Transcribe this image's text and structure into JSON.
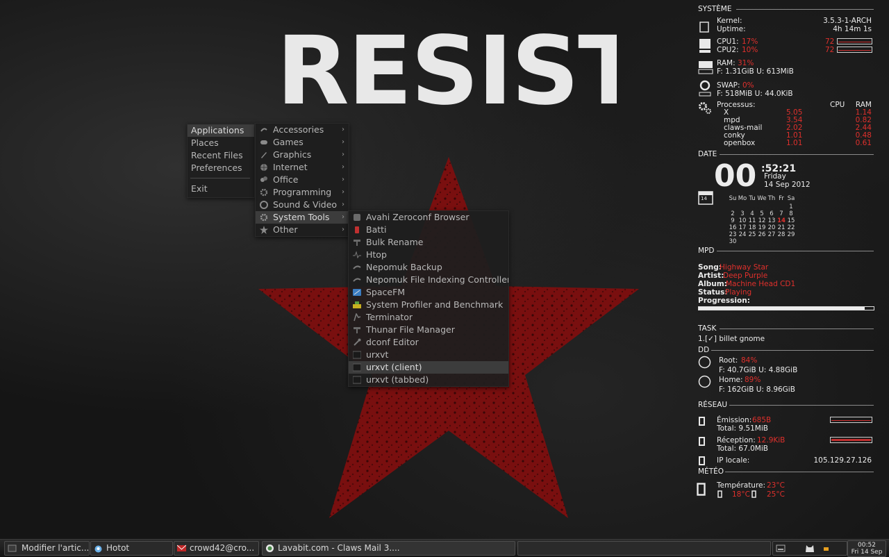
{
  "wallpaper": {
    "title": "RESIST"
  },
  "menu": {
    "main": [
      {
        "label": "Applications",
        "active": true
      },
      {
        "label": "Places"
      },
      {
        "label": "Recent Files"
      },
      {
        "label": "Preferences"
      },
      {
        "label": "Exit"
      }
    ],
    "applications": [
      {
        "label": "Accessories",
        "icon": "accessories-icon"
      },
      {
        "label": "Games",
        "icon": "gamepad-icon"
      },
      {
        "label": "Graphics",
        "icon": "brush-icon"
      },
      {
        "label": "Internet",
        "icon": "globe-icon"
      },
      {
        "label": "Office",
        "icon": "office-icon"
      },
      {
        "label": "Programming",
        "icon": "gear-icon"
      },
      {
        "label": "Sound & Video",
        "icon": "film-icon"
      },
      {
        "label": "System Tools",
        "icon": "gear-icon"
      },
      {
        "label": "Other",
        "icon": "star-icon"
      }
    ],
    "system_tools": [
      {
        "label": "Avahi Zeroconf Browser",
        "icon": "avahi-icon"
      },
      {
        "label": "Batti",
        "icon": "battery-icon"
      },
      {
        "label": "Bulk Rename",
        "icon": "rename-icon"
      },
      {
        "label": "Htop",
        "icon": "pulse-icon"
      },
      {
        "label": "Nepomuk Backup",
        "icon": "nepomuk-icon"
      },
      {
        "label": "Nepomuk File Indexing Controller",
        "icon": "nepomuk-icon"
      },
      {
        "label": "SpaceFM",
        "icon": "spacefm-icon"
      },
      {
        "label": "System Profiler and Benchmark",
        "icon": "profiler-icon"
      },
      {
        "label": "Terminator",
        "icon": "terminator-icon"
      },
      {
        "label": "Thunar File Manager",
        "icon": "thunar-icon"
      },
      {
        "label": "dconf Editor",
        "icon": "wrench-icon"
      },
      {
        "label": "urxvt",
        "icon": "terminal-icon"
      },
      {
        "label": "urxvt (client)",
        "icon": "terminal-icon"
      },
      {
        "label": "urxvt (tabbed)",
        "icon": "terminal-icon"
      }
    ]
  },
  "conky": {
    "systeme": {
      "heading": "SYSTÈME",
      "kernel_label": "Kernel:",
      "kernel": "3.5.3-1-ARCH",
      "uptime_label": "Uptime:",
      "uptime": "4h 14m 1s",
      "cpu1_label": "CPU1:",
      "cpu1": "17%",
      "cpu1_temp": "72",
      "cpu2_label": "CPU2:",
      "cpu2": "10%",
      "cpu2_temp": "72",
      "ram_label": "RAM:",
      "ram": "31%",
      "ram_detail": "F: 1.31GiB U: 613MiB",
      "swap_label": "SWAP:",
      "swap": "0%",
      "swap_detail": "F: 518MiB U: 44.0KiB",
      "proc_label": "Processus:",
      "proc_cpu_header": "CPU",
      "proc_ram_header": "RAM",
      "processes": [
        {
          "name": "X",
          "cpu": "5.05",
          "ram": "1.14"
        },
        {
          "name": "mpd",
          "cpu": "3.54",
          "ram": "0.82"
        },
        {
          "name": "claws-mail",
          "cpu": "2.02",
          "ram": "2.44"
        },
        {
          "name": "conky",
          "cpu": "1.01",
          "ram": "0.48"
        },
        {
          "name": "openbox",
          "cpu": "1.01",
          "ram": "0.61"
        }
      ]
    },
    "date": {
      "heading": "DATE",
      "hour": "00",
      "min_sec": ":52:21",
      "weekday": "Friday",
      "full": "14 Sep 2012",
      "cal_icon_day": "14",
      "weekdays": [
        "Su",
        "Mo",
        "Tu",
        "We",
        "Th",
        "Fr",
        "Sa"
      ],
      "weeks": [
        [
          "",
          "",
          "",
          "",
          "",
          "",
          "1"
        ],
        [
          "2",
          "3",
          "4",
          "5",
          "6",
          "7",
          "8"
        ],
        [
          "9",
          "10",
          "11",
          "12",
          "13",
          "14",
          "15"
        ],
        [
          "16",
          "17",
          "18",
          "19",
          "20",
          "21",
          "22"
        ],
        [
          "23",
          "24",
          "25",
          "26",
          "27",
          "28",
          "29"
        ],
        [
          "30",
          "",
          "",
          "",
          "",
          "",
          ""
        ]
      ],
      "today": "14"
    },
    "mpd": {
      "heading": "MPD",
      "song_label": "Song:",
      "song": "Highway Star",
      "artist_label": "Artist:",
      "artist": "Deep Purple",
      "album_label": "Album:",
      "album": "Machine Head CD1",
      "status_label": "Status:",
      "status": "Playing",
      "progress_label": "Progression:",
      "progress": 0.95
    },
    "task": {
      "heading": "TASK",
      "item": "1.[✓] billet gnome"
    },
    "dd": {
      "heading": "DD",
      "root_label": "Root:",
      "root": "84%",
      "root_detail": "F: 40.7GiB U: 4.88GiB",
      "home_label": "Home:",
      "home": "89%",
      "home_detail": "F: 162GiB U: 8.96GiB"
    },
    "reseau": {
      "heading": "RÉSEAU",
      "up_label": "Émission:",
      "up": "685B",
      "up_total": "Total: 9.51MiB",
      "down_label": "Réception:",
      "down": "12.9KiB",
      "down_total": "Total: 67.0MiB",
      "ip_label": "IP locale:",
      "ip": "105.129.27.126"
    },
    "meteo": {
      "heading": "MÉTÉO",
      "temp_label": "Température:",
      "temp": "23°C",
      "low": "18°C",
      "high": "25°C"
    }
  },
  "taskbar": {
    "tasks": [
      {
        "label": "Modifier l'artic...",
        "icon": "window-icon"
      },
      {
        "label": "Hotot",
        "icon": "hotot-icon"
      },
      {
        "label": "crowd42@cro...",
        "icon": "mail-icon"
      },
      {
        "label": "Lavabit.com - Claws Mail 3....",
        "icon": "claws-icon"
      }
    ],
    "clock_time": "00:52",
    "clock_date": "Fri 14 Sep"
  },
  "colors": {
    "accent": "#e0302c",
    "star": "#8a1010",
    "menu_bg": "#1e1e1e"
  }
}
